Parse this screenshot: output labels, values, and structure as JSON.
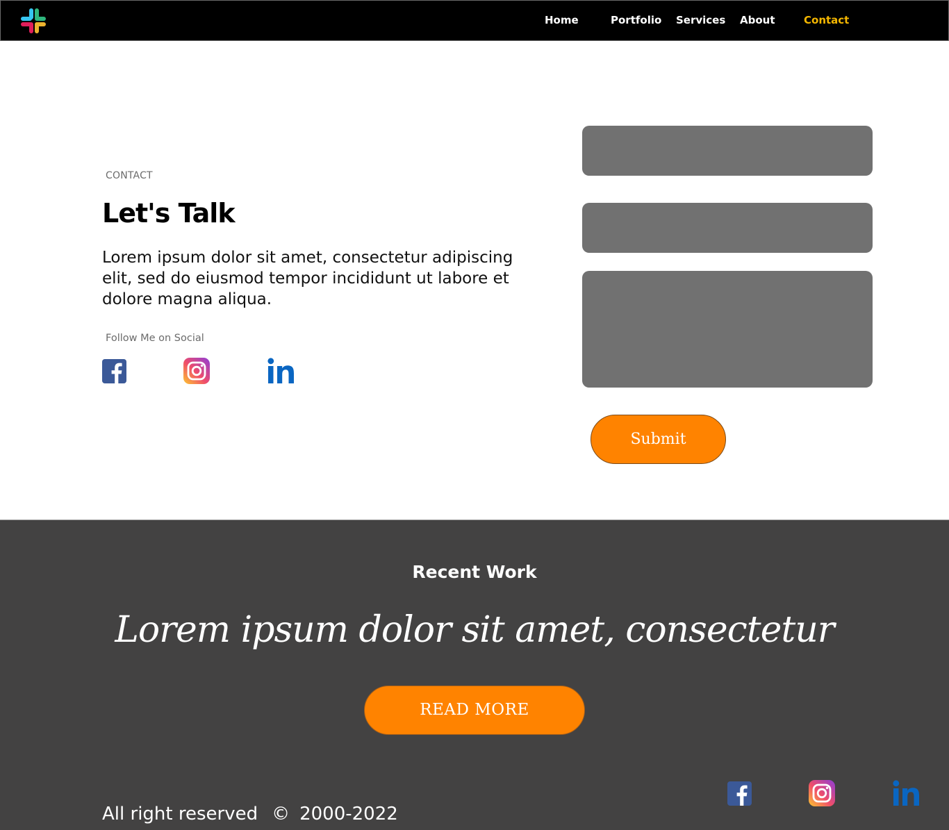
{
  "nav": {
    "items": [
      {
        "label": "Home"
      },
      {
        "label": "Portfolio"
      },
      {
        "label": "Services"
      },
      {
        "label": "About"
      },
      {
        "label": "Contact",
        "active": true
      }
    ]
  },
  "contact": {
    "eyebrow": "CONTACT",
    "headline": "Let's Talk",
    "intro": "Lorem ipsum dolor sit amet, consectetur adipiscing elit, sed do eiusmod tempor incididunt ut labore et dolore magna aliqua.",
    "follow_label": "Follow Me on Social",
    "social_icons": [
      "facebook-icon",
      "instagram-icon",
      "linkedin-icon"
    ],
    "form": {
      "name_value": "",
      "email_value": "",
      "message_value": "",
      "submit_label": "Submit"
    }
  },
  "footer": {
    "recent_title": "Recent Work",
    "tagline": "Lorem ipsum dolor sit amet, consectetur",
    "read_more_label": "READ MORE",
    "copyright_text": "All right reserved",
    "copyright_symbol": "©",
    "copyright_years": "2000-2022"
  },
  "colors": {
    "accent": "#ff8300",
    "nav_active": "#f5b700",
    "footer_bg": "#434242",
    "field_bg": "#717171"
  }
}
